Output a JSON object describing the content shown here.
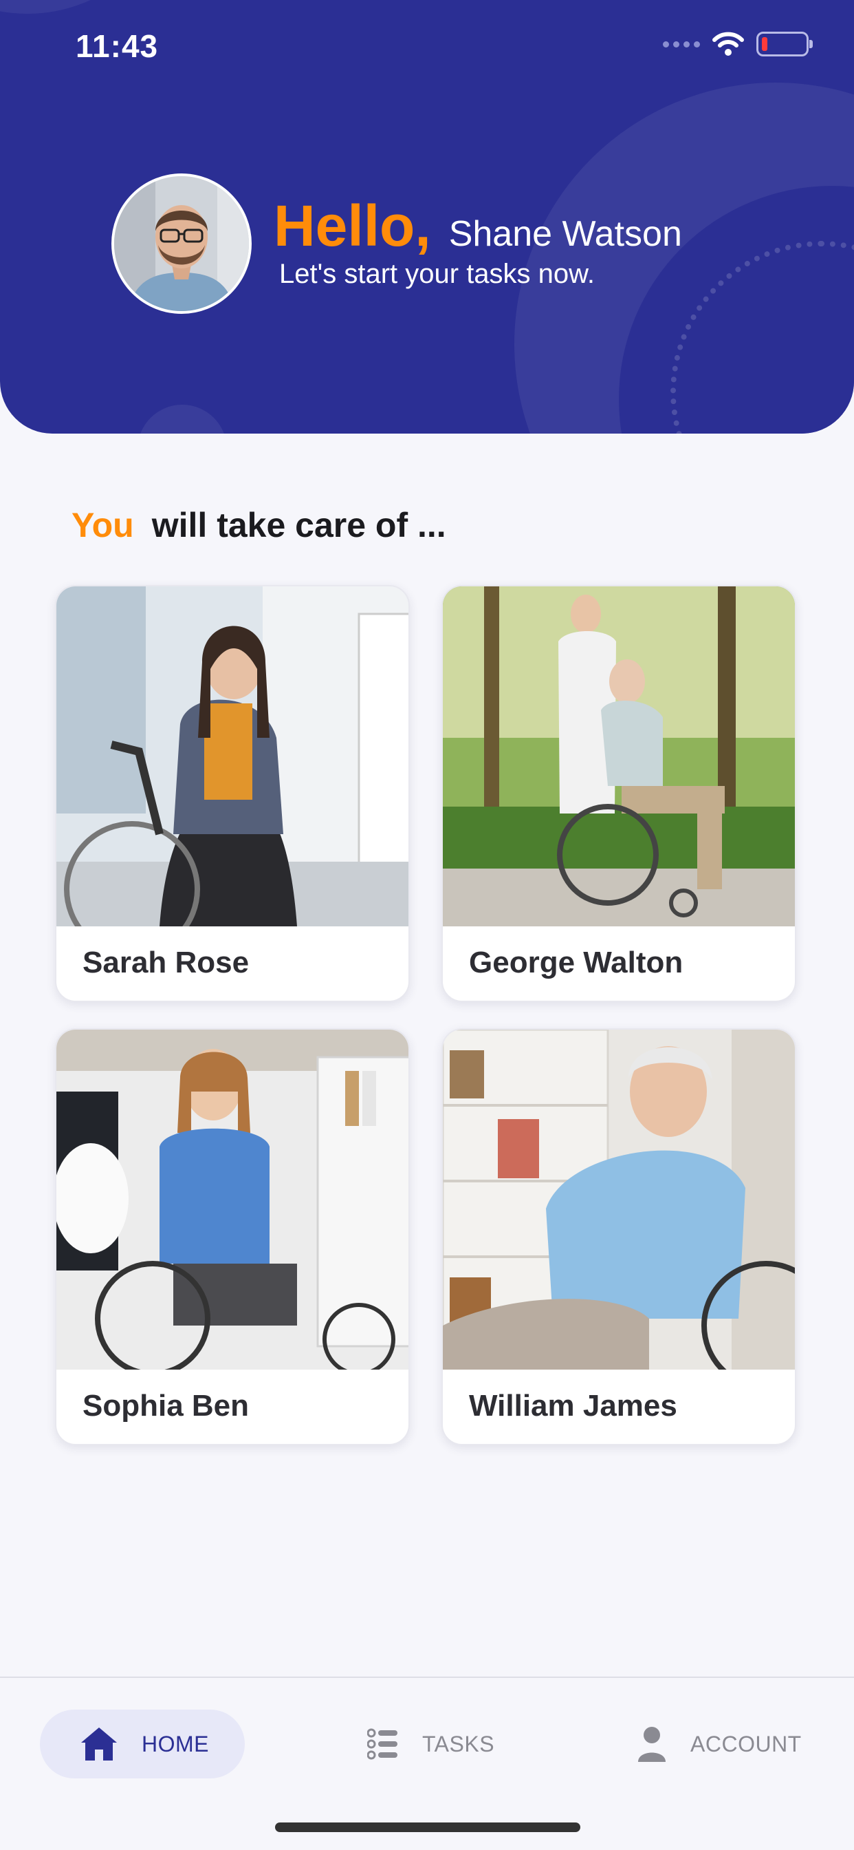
{
  "status_bar": {
    "time": "11:43"
  },
  "header": {
    "greeting": "Hello,",
    "user_name": "Shane Watson",
    "subtitle": "Let's start your tasks now."
  },
  "section": {
    "highlight": "You",
    "title_rest": "will take care of ..."
  },
  "patients": [
    {
      "name": "Sarah Rose"
    },
    {
      "name": "George Walton"
    },
    {
      "name": "Sophia Ben"
    },
    {
      "name": "William James"
    }
  ],
  "nav": {
    "home_label": "HOME",
    "tasks_label": "TASKS",
    "account_label": "ACCOUNT",
    "active": "HOME"
  },
  "colors": {
    "primary": "#2b2f94",
    "accent": "#ff8c0a",
    "background": "#f6f6fb"
  }
}
